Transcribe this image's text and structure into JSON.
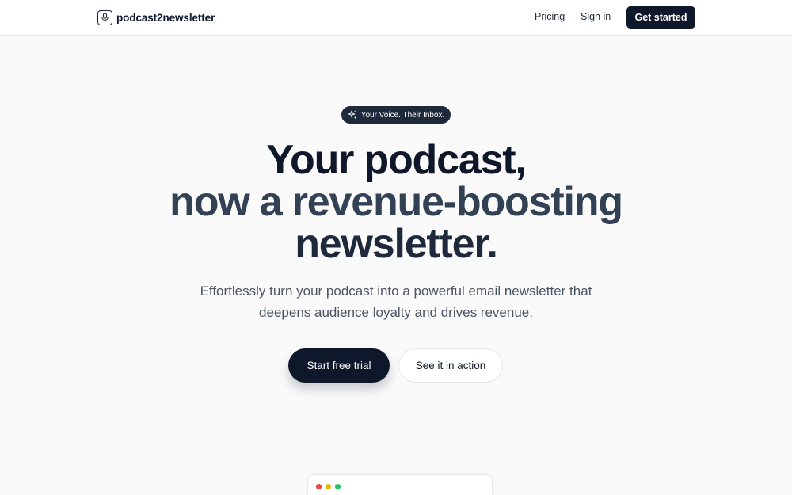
{
  "header": {
    "brand_name": "podcast2newsletter",
    "brand_icon": "microphone-icon",
    "nav": {
      "pricing": "Pricing",
      "sign_in": "Sign in",
      "get_started": "Get started"
    }
  },
  "hero": {
    "badge": "Your Voice. Their Inbox.",
    "badge_icon": "sparkles-icon",
    "headline_line1": "Your podcast,",
    "headline_line2": "now a revenue-boosting",
    "headline_line3": "newsletter.",
    "subtitle": "Effortlessly turn your podcast into a powerful email newsletter that deepens audience loyalty and drives revenue.",
    "cta_primary": "Start free trial",
    "cta_secondary": "See it in action"
  },
  "preview": {
    "window_controls": [
      "close",
      "minimize",
      "maximize"
    ],
    "colors": {
      "close": "#ef4444",
      "minimize": "#eab308",
      "maximize": "#22c55e"
    }
  },
  "colors": {
    "primary": "#0f172a",
    "background": "#fafafa",
    "muted_text": "#4b5563"
  }
}
